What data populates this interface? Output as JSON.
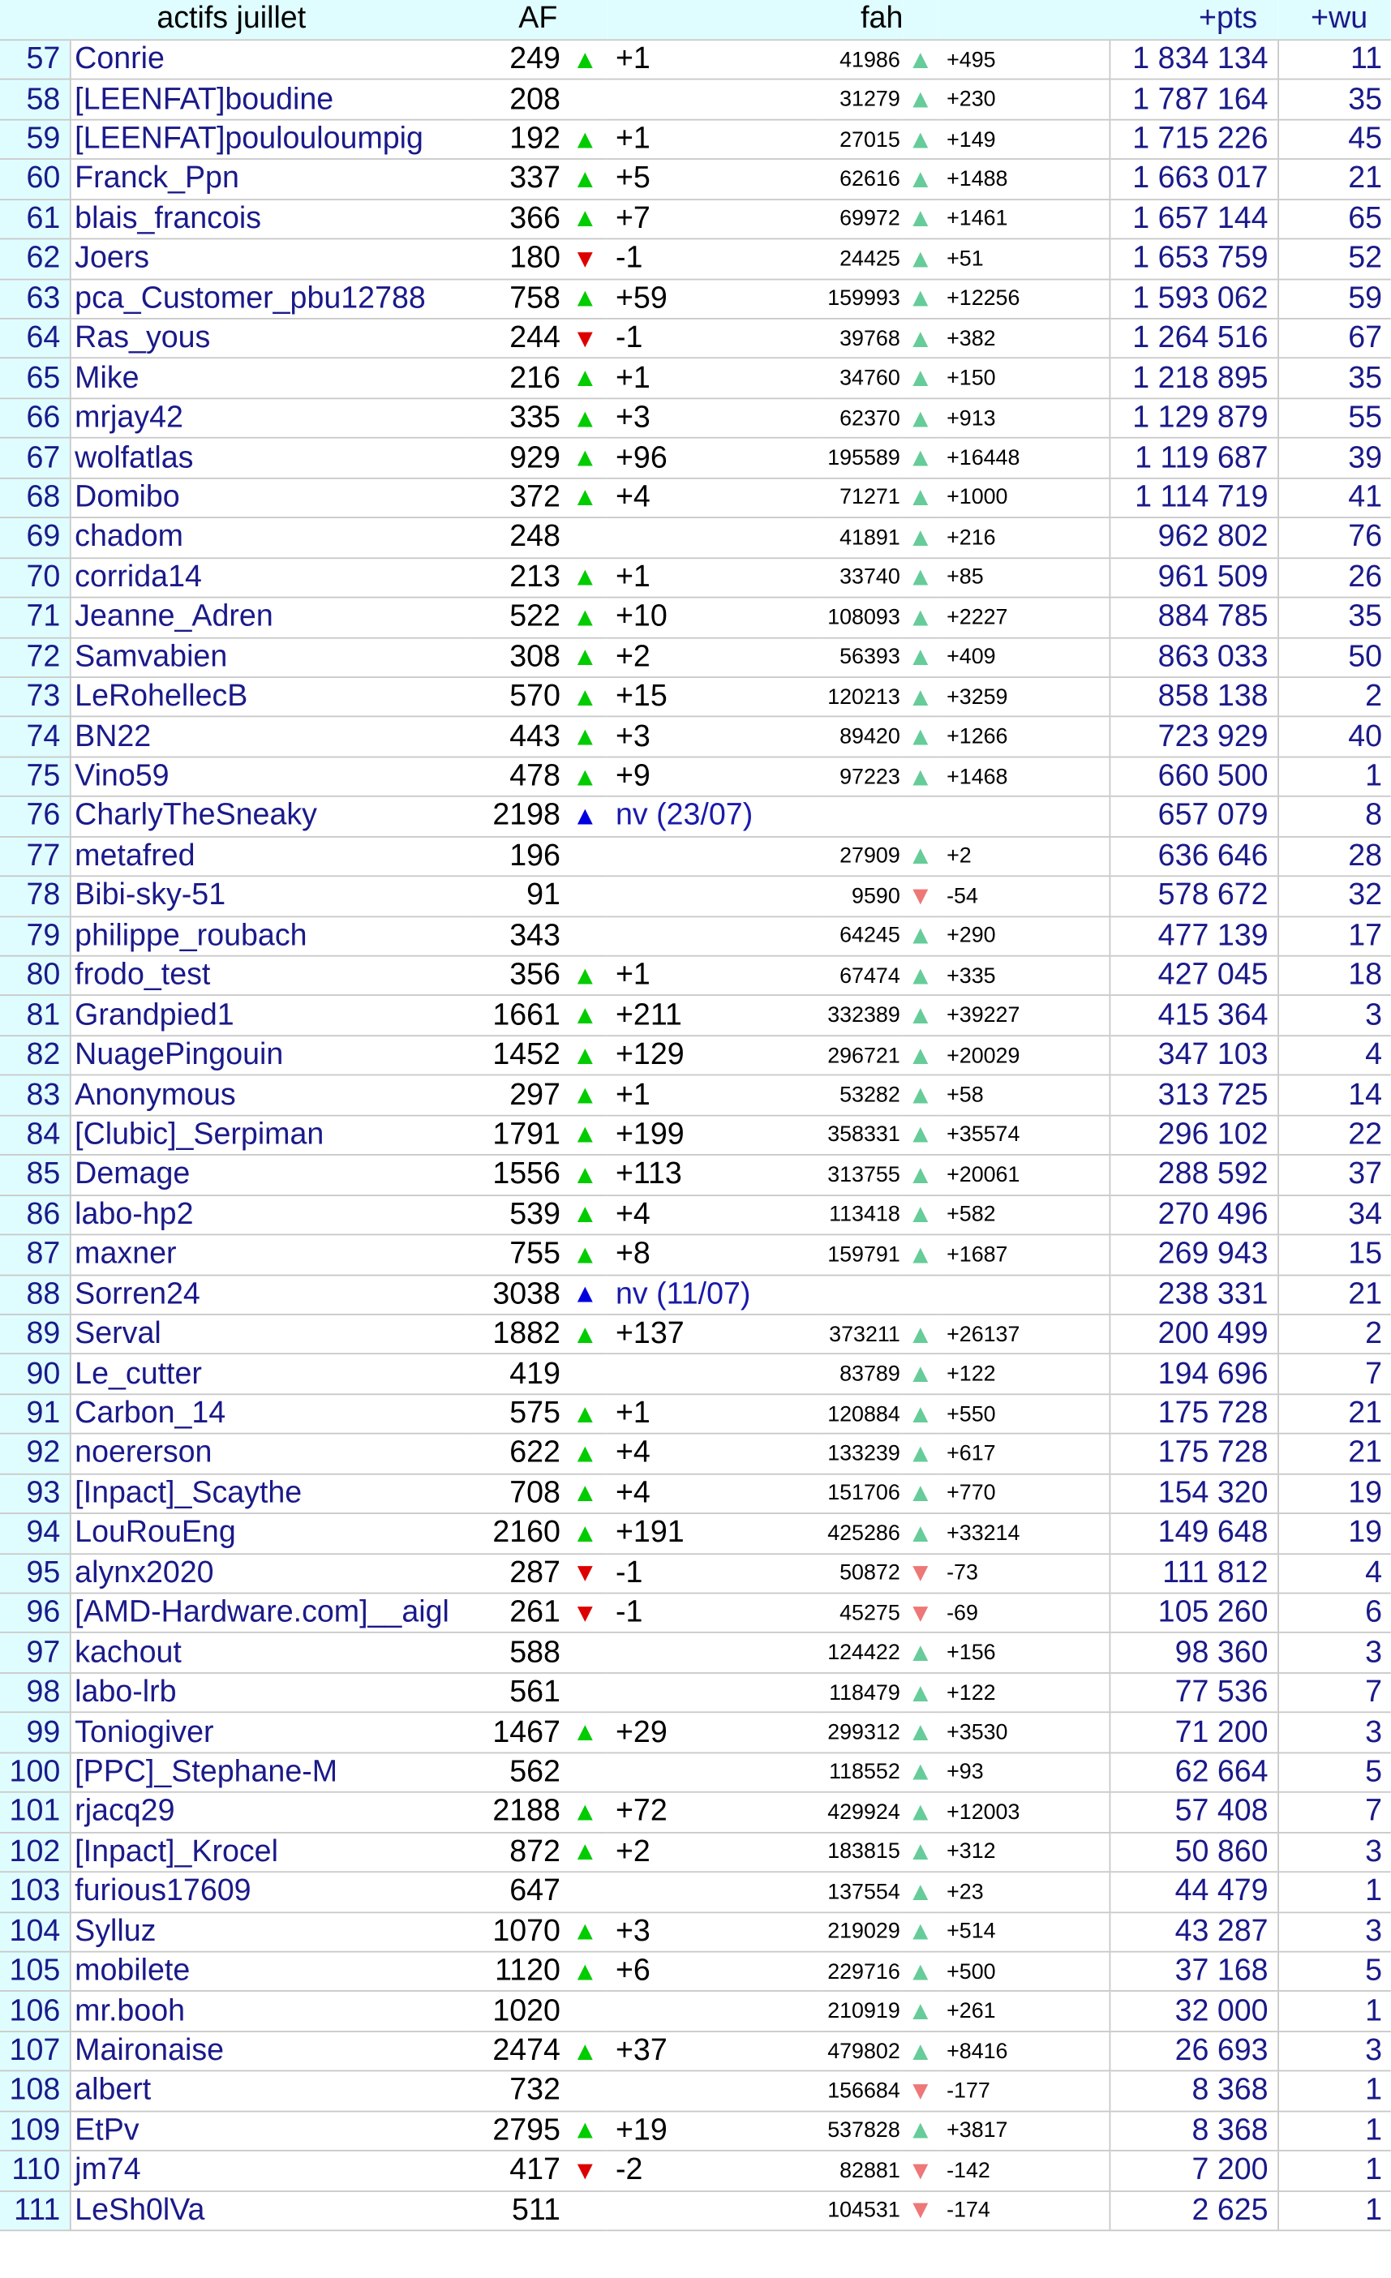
{
  "header": {
    "name": "actifs juillet",
    "af": "AF",
    "fah": "fah",
    "pts": "+pts",
    "wu": "+wu"
  },
  "colors": {
    "header_bg": "#dffdff",
    "up": "#00cc00",
    "down": "#dd0000",
    "new": "#0000dd",
    "fah_up": "#66cc99",
    "fah_down": "#ee7777",
    "link": "#1a1a8a"
  },
  "rows": [
    {
      "rank": "57",
      "name": "Conrie",
      "af": "249",
      "af_dir": "up",
      "af_delta": "+1",
      "fah": "41986",
      "fah_dir": "up",
      "fah_delta": "+495",
      "pts": "1 834 134",
      "wu": "11"
    },
    {
      "rank": "58",
      "name": "[LEENFAT]boudine",
      "af": "208",
      "af_dir": "",
      "af_delta": "",
      "fah": "31279",
      "fah_dir": "up",
      "fah_delta": "+230",
      "pts": "1 787 164",
      "wu": "35"
    },
    {
      "rank": "59",
      "name": "[LEENFAT]poulouloumpig",
      "af": "192",
      "af_dir": "up",
      "af_delta": "+1",
      "fah": "27015",
      "fah_dir": "up",
      "fah_delta": "+149",
      "pts": "1 715 226",
      "wu": "45"
    },
    {
      "rank": "60",
      "name": "Franck_Ppn",
      "af": "337",
      "af_dir": "up",
      "af_delta": "+5",
      "fah": "62616",
      "fah_dir": "up",
      "fah_delta": "+1488",
      "pts": "1 663 017",
      "wu": "21"
    },
    {
      "rank": "61",
      "name": "blais_francois",
      "af": "366",
      "af_dir": "up",
      "af_delta": "+7",
      "fah": "69972",
      "fah_dir": "up",
      "fah_delta": "+1461",
      "pts": "1 657 144",
      "wu": "65"
    },
    {
      "rank": "62",
      "name": "Joers",
      "af": "180",
      "af_dir": "down",
      "af_delta": "-1",
      "fah": "24425",
      "fah_dir": "up",
      "fah_delta": "+51",
      "pts": "1 653 759",
      "wu": "52"
    },
    {
      "rank": "63",
      "name": "pca_Customer_pbu12788",
      "af": "758",
      "af_dir": "up",
      "af_delta": "+59",
      "fah": "159993",
      "fah_dir": "up",
      "fah_delta": "+12256",
      "pts": "1 593 062",
      "wu": "59"
    },
    {
      "rank": "64",
      "name": "Ras_yous",
      "af": "244",
      "af_dir": "down",
      "af_delta": "-1",
      "fah": "39768",
      "fah_dir": "up",
      "fah_delta": "+382",
      "pts": "1 264 516",
      "wu": "67"
    },
    {
      "rank": "65",
      "name": "Mike",
      "af": "216",
      "af_dir": "up",
      "af_delta": "+1",
      "fah": "34760",
      "fah_dir": "up",
      "fah_delta": "+150",
      "pts": "1 218 895",
      "wu": "35"
    },
    {
      "rank": "66",
      "name": "mrjay42",
      "af": "335",
      "af_dir": "up",
      "af_delta": "+3",
      "fah": "62370",
      "fah_dir": "up",
      "fah_delta": "+913",
      "pts": "1 129 879",
      "wu": "55"
    },
    {
      "rank": "67",
      "name": "wolfatlas",
      "af": "929",
      "af_dir": "up",
      "af_delta": "+96",
      "fah": "195589",
      "fah_dir": "up",
      "fah_delta": "+16448",
      "pts": "1 119 687",
      "wu": "39"
    },
    {
      "rank": "68",
      "name": "Domibo",
      "af": "372",
      "af_dir": "up",
      "af_delta": "+4",
      "fah": "71271",
      "fah_dir": "up",
      "fah_delta": "+1000",
      "pts": "1 114 719",
      "wu": "41"
    },
    {
      "rank": "69",
      "name": "chadom",
      "af": "248",
      "af_dir": "",
      "af_delta": "",
      "fah": "41891",
      "fah_dir": "up",
      "fah_delta": "+216",
      "pts": "962 802",
      "wu": "76"
    },
    {
      "rank": "70",
      "name": "corrida14",
      "af": "213",
      "af_dir": "up",
      "af_delta": "+1",
      "fah": "33740",
      "fah_dir": "up",
      "fah_delta": "+85",
      "pts": "961 509",
      "wu": "26"
    },
    {
      "rank": "71",
      "name": "Jeanne_Adren",
      "af": "522",
      "af_dir": "up",
      "af_delta": "+10",
      "fah": "108093",
      "fah_dir": "up",
      "fah_delta": "+2227",
      "pts": "884 785",
      "wu": "35"
    },
    {
      "rank": "72",
      "name": "Samvabien",
      "af": "308",
      "af_dir": "up",
      "af_delta": "+2",
      "fah": "56393",
      "fah_dir": "up",
      "fah_delta": "+409",
      "pts": "863 033",
      "wu": "50"
    },
    {
      "rank": "73",
      "name": "LeRohellecB",
      "af": "570",
      "af_dir": "up",
      "af_delta": "+15",
      "fah": "120213",
      "fah_dir": "up",
      "fah_delta": "+3259",
      "pts": "858 138",
      "wu": "2"
    },
    {
      "rank": "74",
      "name": "BN22",
      "af": "443",
      "af_dir": "up",
      "af_delta": "+3",
      "fah": "89420",
      "fah_dir": "up",
      "fah_delta": "+1266",
      "pts": "723 929",
      "wu": "40"
    },
    {
      "rank": "75",
      "name": "Vino59",
      "af": "478",
      "af_dir": "up",
      "af_delta": "+9",
      "fah": "97223",
      "fah_dir": "up",
      "fah_delta": "+1468",
      "pts": "660 500",
      "wu": "1"
    },
    {
      "rank": "76",
      "name": "CharlyTheSneaky",
      "af": "2198",
      "af_dir": "new",
      "af_delta": "nv (23/07)",
      "fah": "",
      "fah_dir": "",
      "fah_delta": "",
      "pts": "657 079",
      "wu": "8"
    },
    {
      "rank": "77",
      "name": "metafred",
      "af": "196",
      "af_dir": "",
      "af_delta": "",
      "fah": "27909",
      "fah_dir": "up",
      "fah_delta": "+2",
      "pts": "636 646",
      "wu": "28"
    },
    {
      "rank": "78",
      "name": "Bibi-sky-51",
      "af": "91",
      "af_dir": "",
      "af_delta": "",
      "fah": "9590",
      "fah_dir": "down",
      "fah_delta": "-54",
      "pts": "578 672",
      "wu": "32"
    },
    {
      "rank": "79",
      "name": "philippe_roubach",
      "af": "343",
      "af_dir": "",
      "af_delta": "",
      "fah": "64245",
      "fah_dir": "up",
      "fah_delta": "+290",
      "pts": "477 139",
      "wu": "17"
    },
    {
      "rank": "80",
      "name": "frodo_test",
      "af": "356",
      "af_dir": "up",
      "af_delta": "+1",
      "fah": "67474",
      "fah_dir": "up",
      "fah_delta": "+335",
      "pts": "427 045",
      "wu": "18"
    },
    {
      "rank": "81",
      "name": "Grandpied1",
      "af": "1661",
      "af_dir": "up",
      "af_delta": "+211",
      "fah": "332389",
      "fah_dir": "up",
      "fah_delta": "+39227",
      "pts": "415 364",
      "wu": "3"
    },
    {
      "rank": "82",
      "name": "NuagePingouin",
      "af": "1452",
      "af_dir": "up",
      "af_delta": "+129",
      "fah": "296721",
      "fah_dir": "up",
      "fah_delta": "+20029",
      "pts": "347 103",
      "wu": "4"
    },
    {
      "rank": "83",
      "name": "Anonymous",
      "af": "297",
      "af_dir": "up",
      "af_delta": "+1",
      "fah": "53282",
      "fah_dir": "up",
      "fah_delta": "+58",
      "pts": "313 725",
      "wu": "14"
    },
    {
      "rank": "84",
      "name": "[Clubic]_Serpiman",
      "af": "1791",
      "af_dir": "up",
      "af_delta": "+199",
      "fah": "358331",
      "fah_dir": "up",
      "fah_delta": "+35574",
      "pts": "296 102",
      "wu": "22"
    },
    {
      "rank": "85",
      "name": "Demage",
      "af": "1556",
      "af_dir": "up",
      "af_delta": "+113",
      "fah": "313755",
      "fah_dir": "up",
      "fah_delta": "+20061",
      "pts": "288 592",
      "wu": "37"
    },
    {
      "rank": "86",
      "name": "labo-hp2",
      "af": "539",
      "af_dir": "up",
      "af_delta": "+4",
      "fah": "113418",
      "fah_dir": "up",
      "fah_delta": "+582",
      "pts": "270 496",
      "wu": "34"
    },
    {
      "rank": "87",
      "name": "maxner",
      "af": "755",
      "af_dir": "up",
      "af_delta": "+8",
      "fah": "159791",
      "fah_dir": "up",
      "fah_delta": "+1687",
      "pts": "269 943",
      "wu": "15"
    },
    {
      "rank": "88",
      "name": "Sorren24",
      "af": "3038",
      "af_dir": "new",
      "af_delta": "nv (11/07)",
      "fah": "",
      "fah_dir": "",
      "fah_delta": "",
      "pts": "238 331",
      "wu": "21"
    },
    {
      "rank": "89",
      "name": "Serval",
      "af": "1882",
      "af_dir": "up",
      "af_delta": "+137",
      "fah": "373211",
      "fah_dir": "up",
      "fah_delta": "+26137",
      "pts": "200 499",
      "wu": "2"
    },
    {
      "rank": "90",
      "name": "Le_cutter",
      "af": "419",
      "af_dir": "",
      "af_delta": "",
      "fah": "83789",
      "fah_dir": "up",
      "fah_delta": "+122",
      "pts": "194 696",
      "wu": "7"
    },
    {
      "rank": "91",
      "name": "Carbon_14",
      "af": "575",
      "af_dir": "up",
      "af_delta": "+1",
      "fah": "120884",
      "fah_dir": "up",
      "fah_delta": "+550",
      "pts": "175 728",
      "wu": "21"
    },
    {
      "rank": "92",
      "name": "noererson",
      "af": "622",
      "af_dir": "up",
      "af_delta": "+4",
      "fah": "133239",
      "fah_dir": "up",
      "fah_delta": "+617",
      "pts": "175 728",
      "wu": "21"
    },
    {
      "rank": "93",
      "name": "[Inpact]_Scaythe",
      "af": "708",
      "af_dir": "up",
      "af_delta": "+4",
      "fah": "151706",
      "fah_dir": "up",
      "fah_delta": "+770",
      "pts": "154 320",
      "wu": "19"
    },
    {
      "rank": "94",
      "name": "LouRouEng",
      "af": "2160",
      "af_dir": "up",
      "af_delta": "+191",
      "fah": "425286",
      "fah_dir": "up",
      "fah_delta": "+33214",
      "pts": "149 648",
      "wu": "19"
    },
    {
      "rank": "95",
      "name": "alynx2020",
      "af": "287",
      "af_dir": "down",
      "af_delta": "-1",
      "fah": "50872",
      "fah_dir": "down",
      "fah_delta": "-73",
      "pts": "111 812",
      "wu": "4"
    },
    {
      "rank": "96",
      "name": "[AMD-Hardware.com]__aigl",
      "af": "261",
      "af_dir": "down",
      "af_delta": "-1",
      "fah": "45275",
      "fah_dir": "down",
      "fah_delta": "-69",
      "pts": "105 260",
      "wu": "6"
    },
    {
      "rank": "97",
      "name": "kachout",
      "af": "588",
      "af_dir": "",
      "af_delta": "",
      "fah": "124422",
      "fah_dir": "up",
      "fah_delta": "+156",
      "pts": "98 360",
      "wu": "3"
    },
    {
      "rank": "98",
      "name": "labo-lrb",
      "af": "561",
      "af_dir": "",
      "af_delta": "",
      "fah": "118479",
      "fah_dir": "up",
      "fah_delta": "+122",
      "pts": "77 536",
      "wu": "7"
    },
    {
      "rank": "99",
      "name": "Toniogiver",
      "af": "1467",
      "af_dir": "up",
      "af_delta": "+29",
      "fah": "299312",
      "fah_dir": "up",
      "fah_delta": "+3530",
      "pts": "71 200",
      "wu": "3"
    },
    {
      "rank": "100",
      "name": "[PPC]_Stephane-M",
      "af": "562",
      "af_dir": "",
      "af_delta": "",
      "fah": "118552",
      "fah_dir": "up",
      "fah_delta": "+93",
      "pts": "62 664",
      "wu": "5"
    },
    {
      "rank": "101",
      "name": "rjacq29",
      "af": "2188",
      "af_dir": "up",
      "af_delta": "+72",
      "fah": "429924",
      "fah_dir": "up",
      "fah_delta": "+12003",
      "pts": "57 408",
      "wu": "7"
    },
    {
      "rank": "102",
      "name": "[Inpact]_Krocel",
      "af": "872",
      "af_dir": "up",
      "af_delta": "+2",
      "fah": "183815",
      "fah_dir": "up",
      "fah_delta": "+312",
      "pts": "50 860",
      "wu": "3"
    },
    {
      "rank": "103",
      "name": "furious17609",
      "af": "647",
      "af_dir": "",
      "af_delta": "",
      "fah": "137554",
      "fah_dir": "up",
      "fah_delta": "+23",
      "pts": "44 479",
      "wu": "1"
    },
    {
      "rank": "104",
      "name": "Sylluz",
      "af": "1070",
      "af_dir": "up",
      "af_delta": "+3",
      "fah": "219029",
      "fah_dir": "up",
      "fah_delta": "+514",
      "pts": "43 287",
      "wu": "3"
    },
    {
      "rank": "105",
      "name": "mobilete",
      "af": "1120",
      "af_dir": "up",
      "af_delta": "+6",
      "fah": "229716",
      "fah_dir": "up",
      "fah_delta": "+500",
      "pts": "37 168",
      "wu": "5"
    },
    {
      "rank": "106",
      "name": "mr.booh",
      "af": "1020",
      "af_dir": "",
      "af_delta": "",
      "fah": "210919",
      "fah_dir": "up",
      "fah_delta": "+261",
      "pts": "32 000",
      "wu": "1"
    },
    {
      "rank": "107",
      "name": "Maironaise",
      "af": "2474",
      "af_dir": "up",
      "af_delta": "+37",
      "fah": "479802",
      "fah_dir": "up",
      "fah_delta": "+8416",
      "pts": "26 693",
      "wu": "3"
    },
    {
      "rank": "108",
      "name": "albert",
      "af": "732",
      "af_dir": "",
      "af_delta": "",
      "fah": "156684",
      "fah_dir": "down",
      "fah_delta": "-177",
      "pts": "8 368",
      "wu": "1"
    },
    {
      "rank": "109",
      "name": "EtPv",
      "af": "2795",
      "af_dir": "up",
      "af_delta": "+19",
      "fah": "537828",
      "fah_dir": "up",
      "fah_delta": "+3817",
      "pts": "8 368",
      "wu": "1"
    },
    {
      "rank": "110",
      "name": "jm74",
      "af": "417",
      "af_dir": "down",
      "af_delta": "-2",
      "fah": "82881",
      "fah_dir": "down",
      "fah_delta": "-142",
      "pts": "7 200",
      "wu": "1"
    },
    {
      "rank": "111",
      "name": "LeSh0lVa",
      "af": "511",
      "af_dir": "",
      "af_delta": "",
      "fah": "104531",
      "fah_dir": "down",
      "fah_delta": "-174",
      "pts": "2 625",
      "wu": "1"
    }
  ]
}
